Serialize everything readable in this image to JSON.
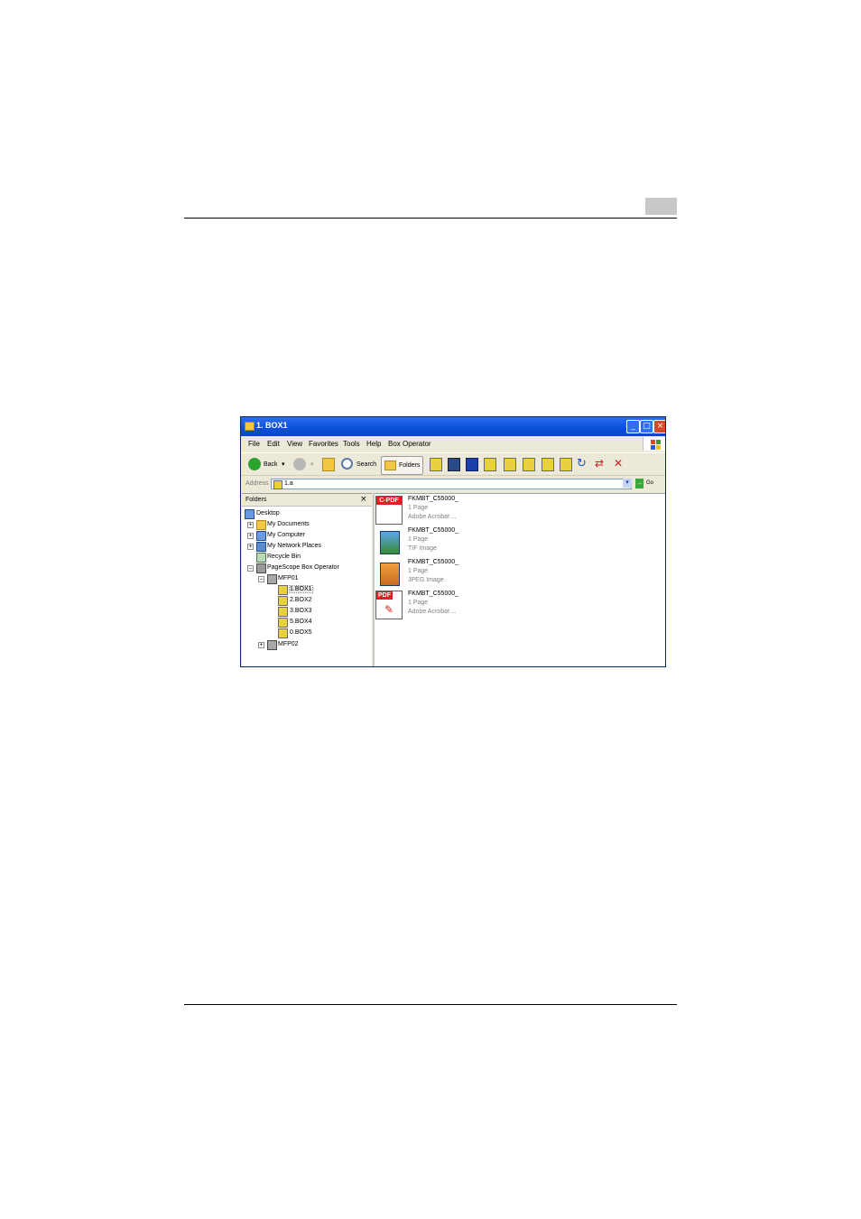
{
  "window": {
    "title": "1. BOX1",
    "controls": [
      "minimize",
      "maximize",
      "close"
    ]
  },
  "menu": [
    "File",
    "Edit",
    "View",
    "Favorites",
    "Tools",
    "Help",
    "Box Operator"
  ],
  "toolbar": {
    "back_label": "Back",
    "search_label": "Search",
    "folders_label": "Folders"
  },
  "address": {
    "label": "Address",
    "value": "1.a",
    "go_label": "Go"
  },
  "folders_pane": {
    "title": "Folders",
    "close_glyph": "×",
    "tree": [
      {
        "label": "Desktop",
        "icon": "desktop-icon"
      },
      {
        "label": "My Documents",
        "icon": "folder-icon"
      },
      {
        "label": "My Computer",
        "icon": "computer-icon"
      },
      {
        "label": "My Network Places",
        "icon": "network-icon"
      },
      {
        "label": "Recycle Bin",
        "icon": "recycle-bin-icon"
      },
      {
        "label": "PageScope Box Operator",
        "icon": "box-operator-icon"
      },
      {
        "label": "MFP01",
        "icon": "mfp-icon"
      },
      {
        "label": "1.BOX1",
        "icon": "box-icon"
      },
      {
        "label": "2.BOX2",
        "icon": "box-icon"
      },
      {
        "label": "3.BOX3",
        "icon": "box-icon"
      },
      {
        "label": "5.BOX4",
        "icon": "box-icon"
      },
      {
        "label": "0.BOX5",
        "icon": "box-icon"
      },
      {
        "label": "MFP02",
        "icon": "mfp-icon"
      }
    ]
  },
  "files": [
    {
      "name": "FKMBT_C55000_",
      "pages": "1 Page",
      "type": "Adobe Acrobat ...",
      "thumb": "C-PDF",
      "icon": "compact-pdf-icon"
    },
    {
      "name": "FKMBT_C55000_",
      "pages": "1 Page",
      "type": "TIF Image",
      "thumb": "",
      "icon": "tif-image-icon"
    },
    {
      "name": "FKMBT_C55000_",
      "pages": "1 Page",
      "type": "JPEG Image",
      "thumb": "",
      "icon": "jpeg-image-icon"
    },
    {
      "name": "FKMBT_C55000_",
      "pages": "1 Page",
      "type": "Adobe Acrobat ...",
      "thumb": "PDF",
      "icon": "pdf-icon"
    }
  ],
  "colors": {
    "titlebar": "#0a4fd8",
    "window_bg": "#ece9d8",
    "close_button": "#d8492a",
    "pdf_red": "#e02020",
    "page_tab": "#c8c8c8"
  }
}
